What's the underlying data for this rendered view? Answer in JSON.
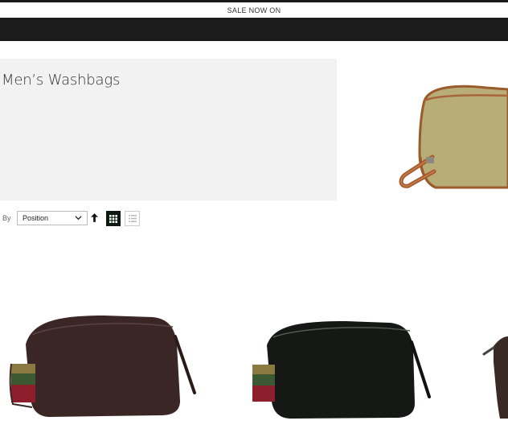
{
  "promo": {
    "text": "SALE NOW ON"
  },
  "category": {
    "title": "Men’s Washbags"
  },
  "toolbar": {
    "sort_label": "By",
    "sort_value": "Position"
  },
  "icons": {
    "sort_direction": "arrow-up-icon",
    "grid_mode": "grid-icon",
    "list_mode": "list-icon",
    "select_chevron": "chevron-down-icon"
  },
  "colors": {
    "header_bg": "#1b1b1b",
    "hero_bg": "#f2f2f2",
    "active_view": "#0b1a12"
  }
}
